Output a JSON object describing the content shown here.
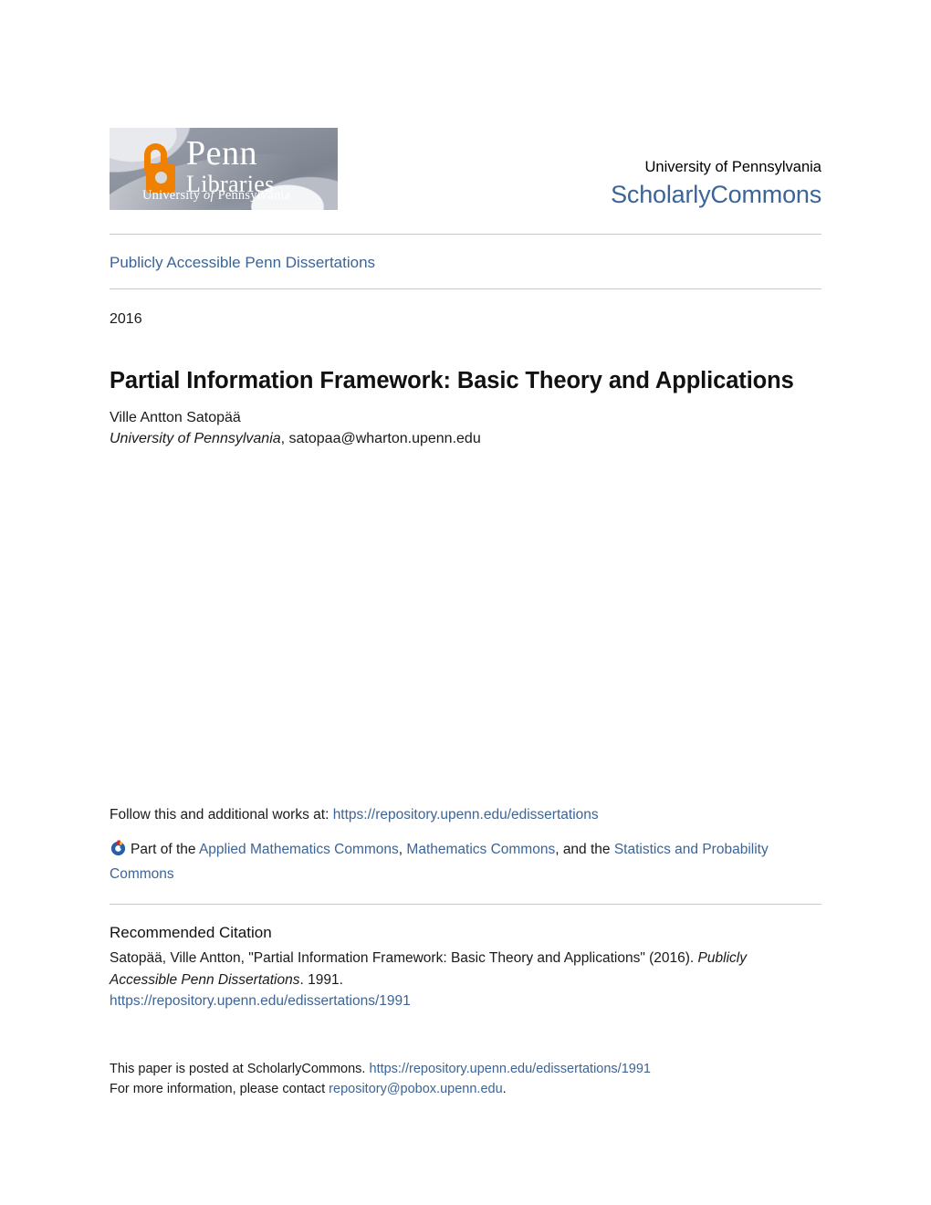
{
  "header": {
    "logo": {
      "name": "penn-libraries-logo",
      "penn": "Penn",
      "libraries": "Libraries",
      "university_small": "University",
      "of_small": " of ",
      "pennsylvania_small": "Pennsylvania"
    },
    "university": "University of Pennsylvania",
    "repository_name": "ScholarlyCommons"
  },
  "series": {
    "label": "Publicly Accessible Penn Dissertations"
  },
  "record": {
    "year": "2016",
    "title": "Partial Information Framework: Basic Theory and Applications",
    "author_name": "Ville Antton Satopää",
    "author_affiliation": "University of Pennsylvania",
    "author_affiliation_sep": ", ",
    "author_email": "satopaa@wharton.upenn.edu"
  },
  "follow": {
    "prefix": "Follow this and additional works at: ",
    "url": "https://repository.upenn.edu/edissertations",
    "part_of": "Part of the ",
    "commons": [
      "Applied Mathematics Commons",
      "Mathematics Commons",
      "Statistics and Probability Commons"
    ],
    "sep1": ", ",
    "sep2": ", and the "
  },
  "citation": {
    "heading": "Recommended Citation",
    "text_part1": "Satopää, Ville Antton, \"Partial Information Framework: Basic Theory and Applications\" (2016). ",
    "series_italic": "Publicly Accessible Penn Dissertations",
    "text_part2": ". 1991.",
    "url": "https://repository.upenn.edu/edissertations/1991"
  },
  "footer": {
    "line1_prefix": "This paper is posted at ScholarlyCommons. ",
    "line1_url": "https://repository.upenn.edu/edissertations/1991",
    "line2_prefix": "For more information, please contact ",
    "line2_email": "repository@pobox.upenn.edu",
    "line2_suffix": "."
  },
  "colors": {
    "link_blue": "#3c6496",
    "rule_gray": "#c8c8c8",
    "logo_orange": "#f08000",
    "text_black": "#1a1a1a"
  }
}
